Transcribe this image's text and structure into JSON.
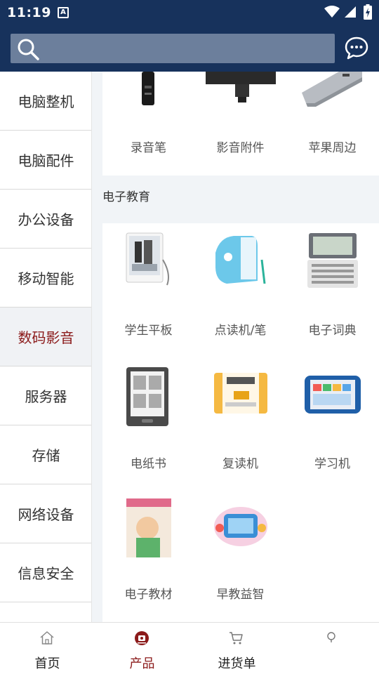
{
  "status_bar": {
    "time": "11:19",
    "notification_glyph": "A"
  },
  "search": {
    "placeholder": "",
    "value": ""
  },
  "icons": {
    "search": "search-icon",
    "chat": "chat-bubble-icon"
  },
  "sidebar": {
    "items": [
      {
        "label": "电脑整机",
        "active": false
      },
      {
        "label": "电脑配件",
        "active": false
      },
      {
        "label": "办公设备",
        "active": false
      },
      {
        "label": "移动智能",
        "active": false
      },
      {
        "label": "数码影音",
        "active": true
      },
      {
        "label": "服务器",
        "active": false
      },
      {
        "label": "存储",
        "active": false
      },
      {
        "label": "网络设备",
        "active": false
      },
      {
        "label": "信息安全",
        "active": false
      }
    ]
  },
  "top_section": {
    "items": [
      {
        "label": "录音笔"
      },
      {
        "label": "影音附件"
      },
      {
        "label": "苹果周边"
      }
    ]
  },
  "education_section": {
    "title": "电子教育",
    "items": [
      {
        "label": "学生平板"
      },
      {
        "label": "点读机/笔"
      },
      {
        "label": "电子词典"
      },
      {
        "label": "电纸书"
      },
      {
        "label": "复读机"
      },
      {
        "label": "学习机"
      },
      {
        "label": "电子教材"
      },
      {
        "label": "早教益智"
      }
    ]
  },
  "bottom_nav": {
    "items": [
      {
        "label": "首页",
        "icon": "home-icon",
        "active": false
      },
      {
        "label": "产品",
        "icon": "product-icon",
        "active": true
      },
      {
        "label": "进货单",
        "icon": "cart-icon",
        "active": false
      },
      {
        "label": "",
        "icon": "pin-icon",
        "active": false
      }
    ]
  },
  "colors": {
    "header": "#17325c",
    "search_bg": "#6c7f9c",
    "accent": "#8b1a1a",
    "content_bg": "#f1f4f7"
  }
}
